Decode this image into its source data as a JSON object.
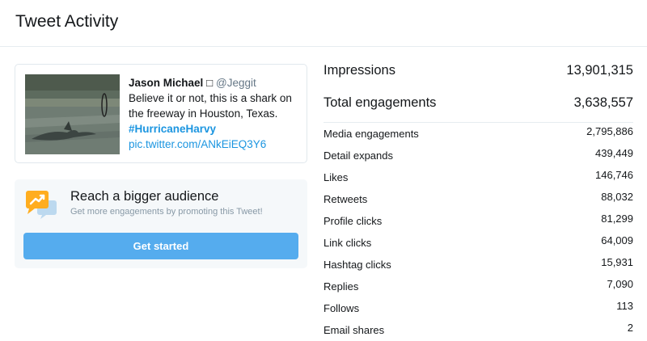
{
  "header": {
    "title": "Tweet Activity"
  },
  "tweet": {
    "author_name": "Jason Michael",
    "badge": "□",
    "handle": "@Jeggit",
    "text": "Believe it or not, this is a shark on the freeway in Houston, Texas.",
    "hashtag": "#HurricaneHarvy",
    "link": "pic.twitter.com/ANkEiEQ3Y6"
  },
  "promo": {
    "title": "Reach a bigger audience",
    "subtitle": "Get more engagements by promoting this Tweet!",
    "button_label": "Get started",
    "icon": "megaphone-chart-icon"
  },
  "metrics": {
    "major": [
      {
        "label": "Impressions",
        "value": "13,901,315"
      },
      {
        "label": "Total engagements",
        "value": "3,638,557"
      }
    ],
    "minor": [
      {
        "label": "Media engagements",
        "value": "2,795,886"
      },
      {
        "label": "Detail expands",
        "value": "439,449"
      },
      {
        "label": "Likes",
        "value": "146,746"
      },
      {
        "label": "Retweets",
        "value": "88,032"
      },
      {
        "label": "Profile clicks",
        "value": "81,299"
      },
      {
        "label": "Link clicks",
        "value": "64,009"
      },
      {
        "label": "Hashtag clicks",
        "value": "15,931"
      },
      {
        "label": "Replies",
        "value": "7,090"
      },
      {
        "label": "Follows",
        "value": "113"
      },
      {
        "label": "Email shares",
        "value": "2"
      }
    ]
  },
  "colors": {
    "accent": "#55acee",
    "link": "#1b95e0",
    "promo_bg": "#f5f8fa"
  }
}
